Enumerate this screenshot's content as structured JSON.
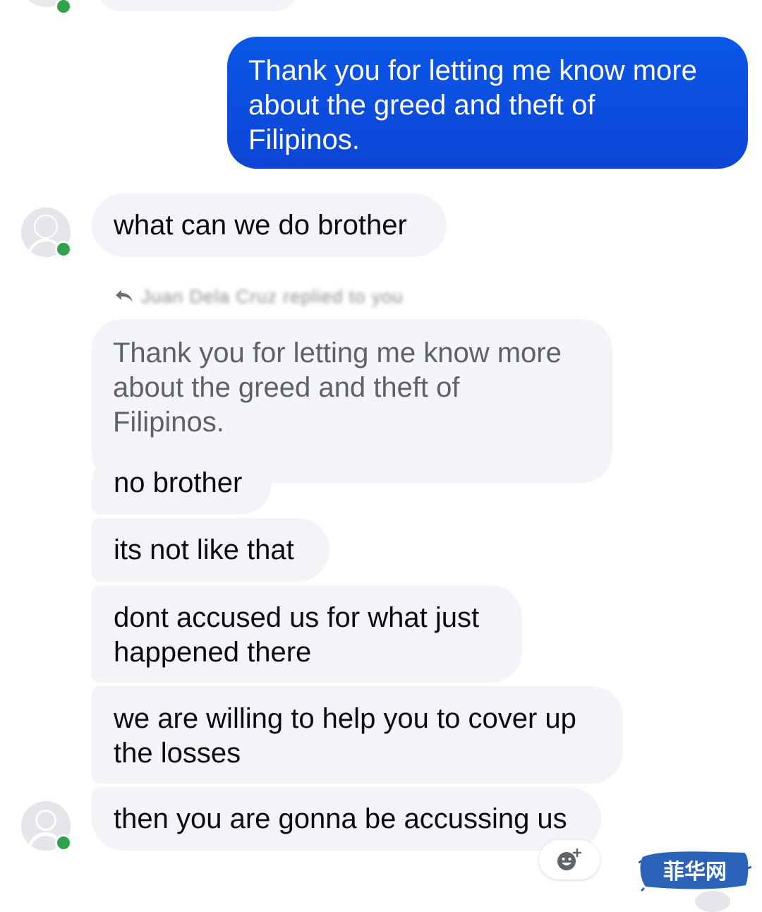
{
  "messages": {
    "outgoing_1": "Thank you for letting me know more\nabout the greed and theft of\nFilipinos.",
    "incoming_1": "what can we do brother",
    "quoted_text": "Thank you for letting me know more\nabout the greed and theft of\nFilipinos.",
    "incoming_2": "no brother",
    "incoming_3": "its not like that",
    "incoming_4": "dont accused us for what just\nhappened there",
    "incoming_5": "we are willing to help you to cover up\nthe losses",
    "incoming_6": "then you are gonna be accussing us"
  },
  "reply_header": {
    "icon": "reply-arrow-icon",
    "sender_name": "Juan Dela Cruz replied to you"
  },
  "reaction": {
    "icon": "add-reaction-icon"
  },
  "watermark": {
    "text": "菲华网"
  },
  "colors": {
    "outgoing_bubble": "#0f4fe1",
    "incoming_bubble": "#f3f4f7",
    "online_dot": "#31a24c",
    "watermark_bg": "#2a63b8"
  }
}
